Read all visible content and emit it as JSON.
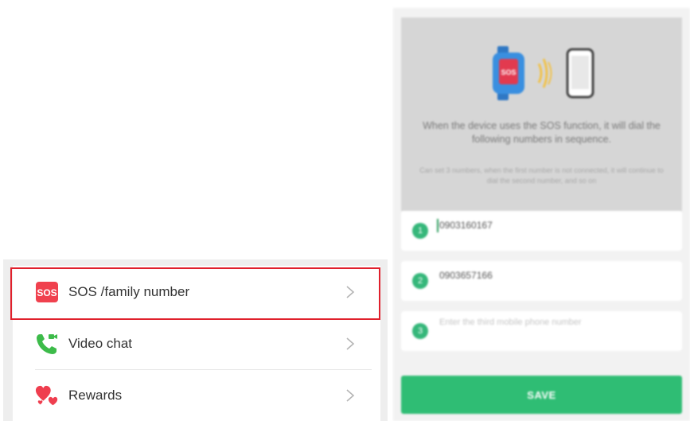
{
  "menu": {
    "items": [
      {
        "label": "SOS /family number",
        "icon": "sos-icon",
        "badge_text": "SOS"
      },
      {
        "label": "Video chat",
        "icon": "video-call-icon"
      },
      {
        "label": "Rewards",
        "icon": "hearts-icon"
      }
    ]
  },
  "sos_screen": {
    "title": "When the device uses the SOS function, it will dial the following numbers in sequence.",
    "subtitle": "Can set 3 numbers, when the first number is not connected, it will continue to dial the second number, and so on",
    "numbers": [
      {
        "index": "1",
        "value": "0903160167"
      },
      {
        "index": "2",
        "value": "0903657166"
      },
      {
        "index": "3",
        "value": "",
        "placeholder": "Enter the third mobile phone number"
      }
    ],
    "save_label": "SAVE"
  },
  "colors": {
    "highlight": "#e0202c",
    "sos_red": "#f0414e",
    "video_green": "#3dbb4a",
    "heart_red": "#ef3e4f",
    "save_green": "#2fbd74",
    "badge_green": "#35b77a",
    "watch_blue": "#3a8fe0"
  }
}
